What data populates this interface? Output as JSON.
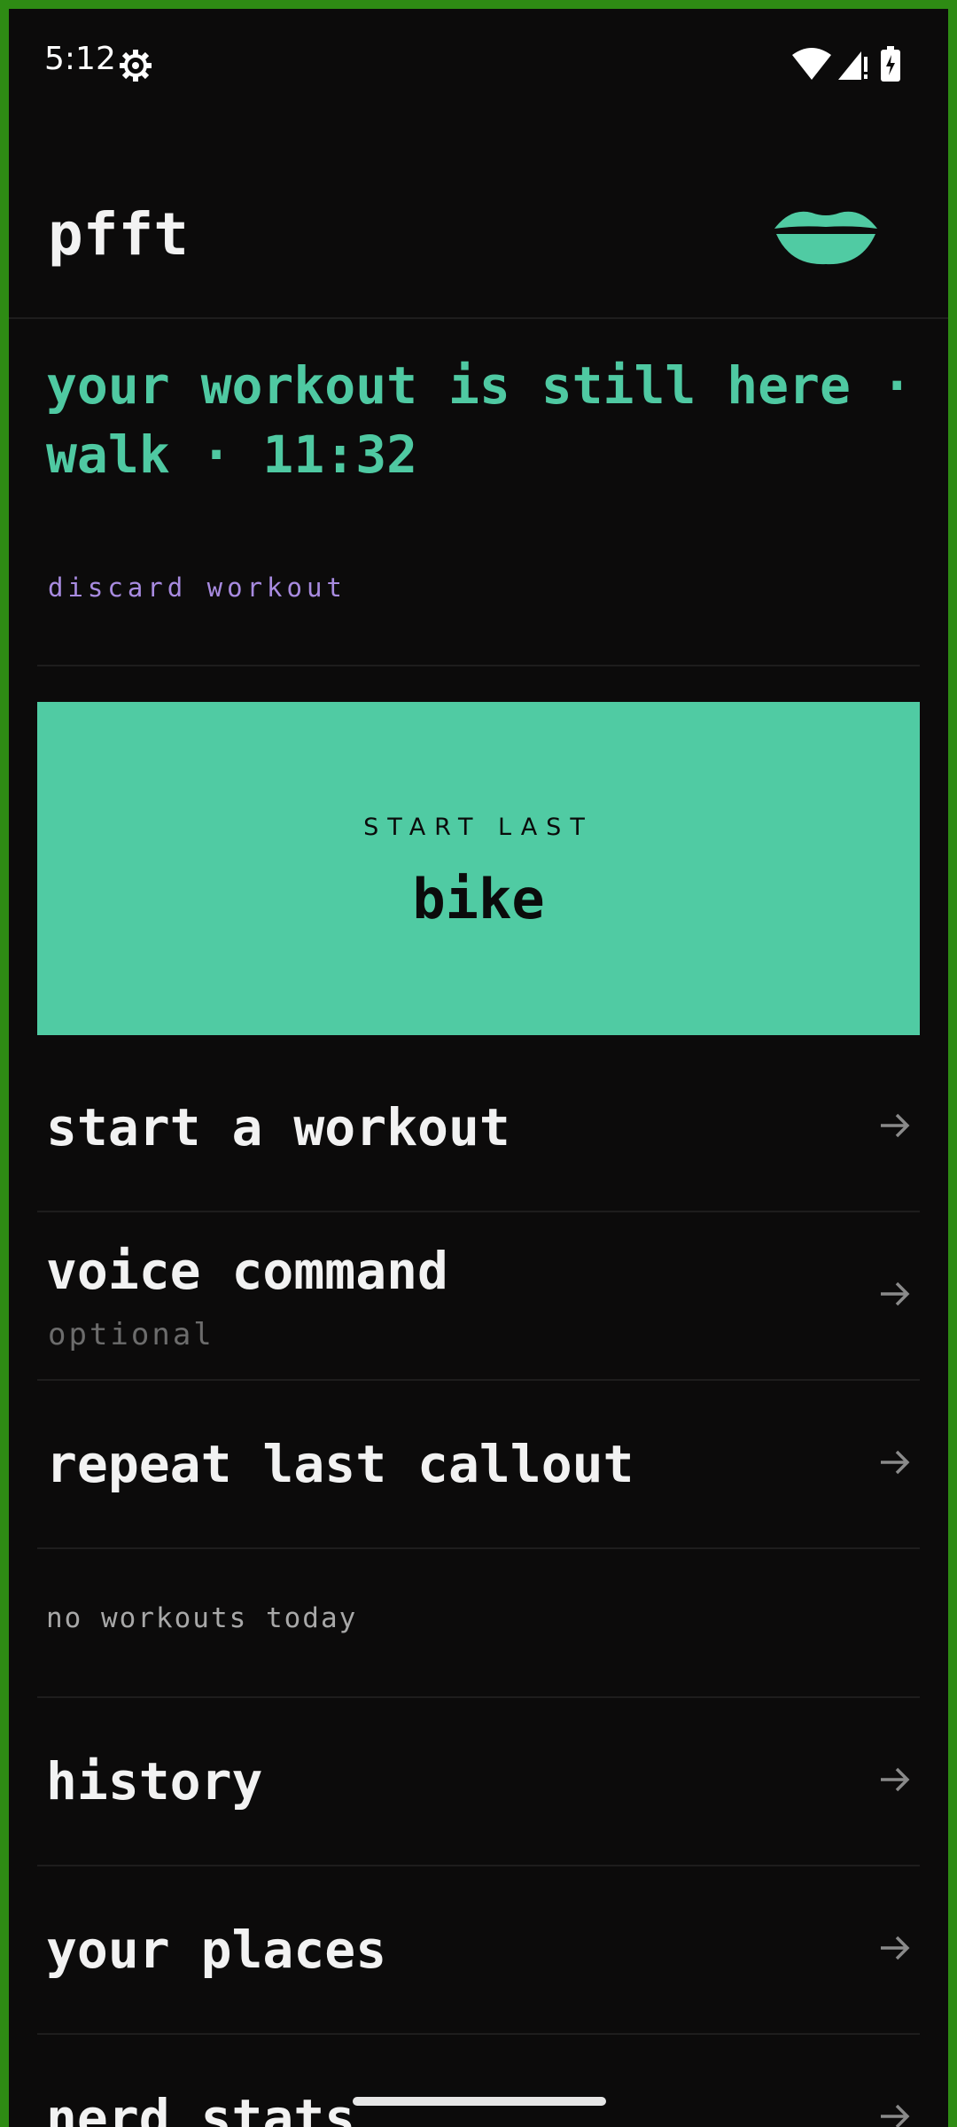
{
  "status_bar": {
    "time": "5:12",
    "icons": [
      "gear-icon",
      "wifi-icon",
      "signal-icon",
      "battery-charging-icon"
    ]
  },
  "header": {
    "app_title": "pfft",
    "logo_icon": "lips-icon",
    "accent_color": "#50cba3"
  },
  "resume_banner": {
    "message": "your workout is still here · walk · 11:32",
    "discard_label": "discard workout"
  },
  "start_last": {
    "label": "START LAST",
    "workout_name": "bike"
  },
  "menu": {
    "start_workout": "start a workout",
    "voice_command": "voice command",
    "voice_command_sub": "optional",
    "repeat_callout": "repeat last callout",
    "today_note": "no workouts today",
    "history": "history",
    "your_places": "your places",
    "nerd_stats": "nerd stats"
  }
}
